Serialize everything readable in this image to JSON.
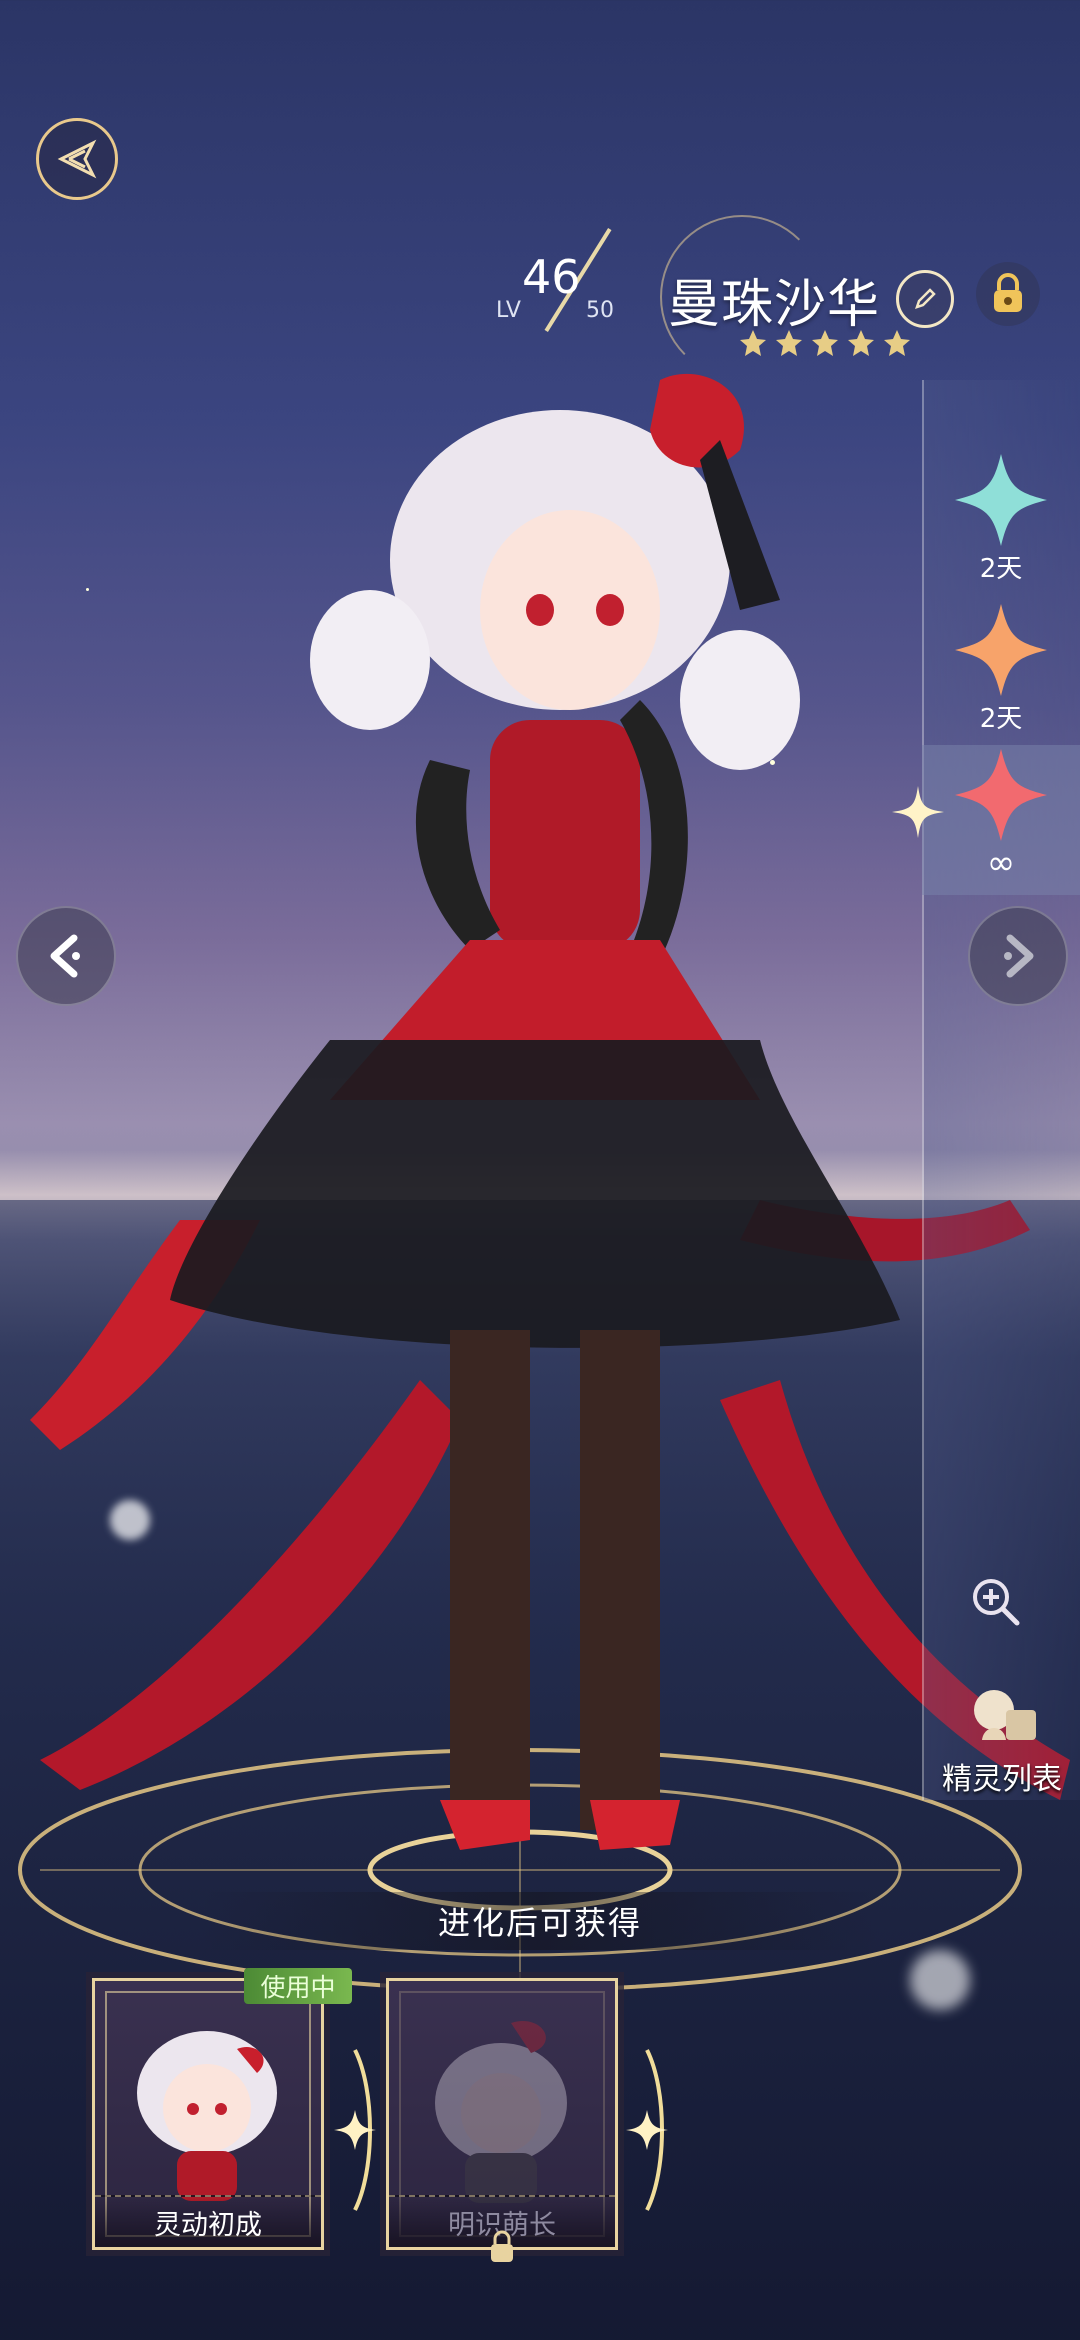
{
  "header": {
    "level_label": "LV",
    "level_current": "46",
    "level_max": "50",
    "name": "曼珠沙华",
    "star_count": 5
  },
  "skins": [
    {
      "label": "2天",
      "color": "#8fdfd8"
    },
    {
      "label": "2天",
      "color": "#f7a36a"
    },
    {
      "label": "∞",
      "color": "#f26a6f"
    }
  ],
  "tools": {
    "elf_list_label": "精灵列表"
  },
  "evolve": {
    "banner": "进化后可获得",
    "forms": [
      {
        "caption": "灵动初成",
        "status": "使用中"
      },
      {
        "caption": "明识萌长",
        "locked": true
      }
    ]
  },
  "colors": {
    "gold": "#e8d3a0",
    "accent_red": "#c8202e"
  }
}
